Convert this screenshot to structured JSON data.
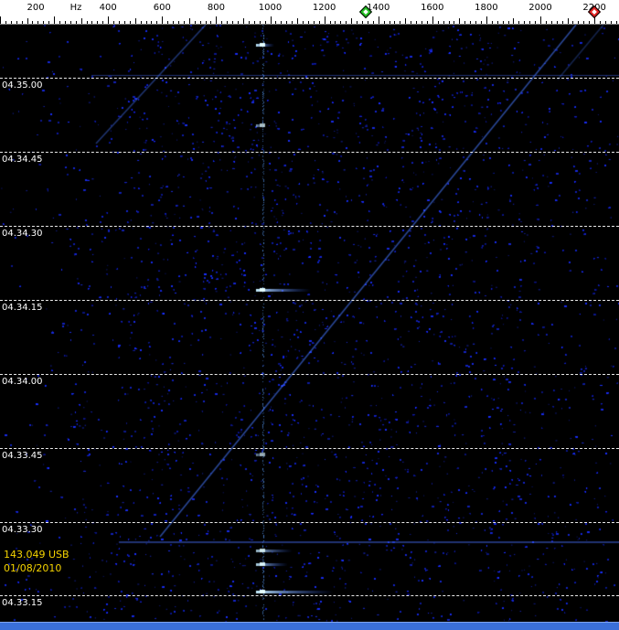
{
  "scale": {
    "unit": "Hz",
    "labels": [
      "200",
      "400",
      "600",
      "800",
      "1000",
      "1200",
      "1400",
      "1600",
      "1800",
      "2000",
      "2200"
    ],
    "min_hz": 0,
    "max_hz": 2300,
    "markers": [
      {
        "name": "green-marker",
        "color": "#22c022",
        "hz": 1355
      },
      {
        "name": "red-marker",
        "color": "#e02020",
        "hz": 2200
      }
    ]
  },
  "waterfall": {
    "timestamps": [
      "04.35.00",
      "04.34.45",
      "04.34.30",
      "04.34.15",
      "04.34.00",
      "04.33.45",
      "04.33.30",
      "04.33.15"
    ],
    "info_frequency": "143.049 USB",
    "info_date": "01/08/2010"
  },
  "colors": {
    "noise": "#1a2cff",
    "signal": "#7fd8ff",
    "info_text": "#f5d400"
  }
}
